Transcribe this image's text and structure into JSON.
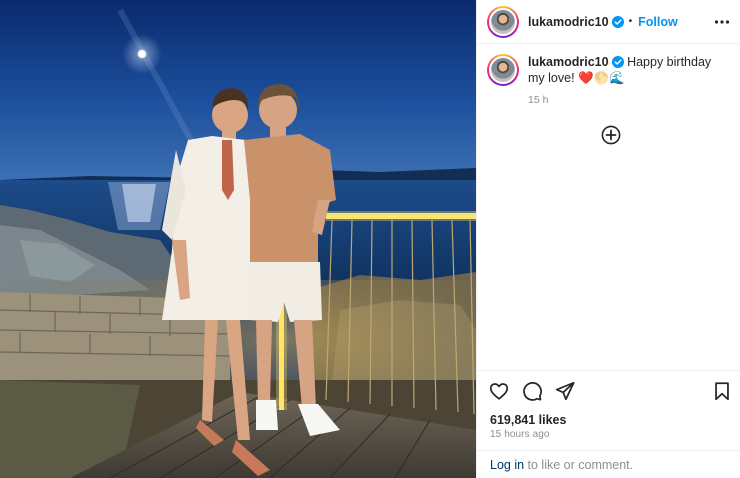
{
  "post": {
    "username": "lukamodric10",
    "follow_label": "Follow",
    "separator": "•",
    "verified_icon": "verified-badge-icon",
    "more_icon": "more-options-icon"
  },
  "caption": {
    "username": "lukamodric10",
    "text": "Happy birthday my love! ❤️🌕🌊",
    "time": "15 h"
  },
  "actions": {
    "icons": [
      "heart-icon",
      "comment-icon",
      "share-icon",
      "bookmark-icon"
    ],
    "likes": "619,841 likes",
    "time_ago": "15 hours ago"
  },
  "login": {
    "link": "Log in",
    "rest": " to like or comment."
  },
  "colors": {
    "accent": "#0095f6",
    "text": "#262626",
    "secondary": "#8e8e8e",
    "link": "#00376b",
    "divider": "#efefef"
  }
}
